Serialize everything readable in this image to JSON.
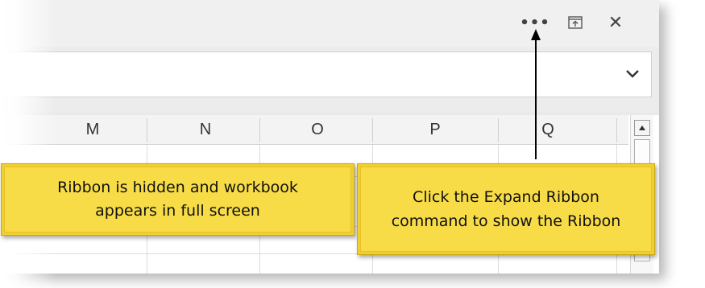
{
  "window": {
    "more_options_label": "•••",
    "close_label": "✕"
  },
  "columns": [
    "M",
    "N",
    "O",
    "P",
    "Q"
  ],
  "callouts": {
    "left_line1": "Ribbon is hidden and workbook",
    "left_line2": "appears in full screen",
    "right_line1": "Click the Expand Ribbon",
    "right_line2": "command to show the Ribbon"
  },
  "colors": {
    "callout_fill": "#f7dc47",
    "arrow": "#000000"
  },
  "icons": {
    "more": "more-options-icon",
    "restore": "expand-ribbon-icon",
    "close": "close-icon",
    "formula_expand": "chevron-down-icon",
    "scroll_up": "scroll-up-icon"
  }
}
